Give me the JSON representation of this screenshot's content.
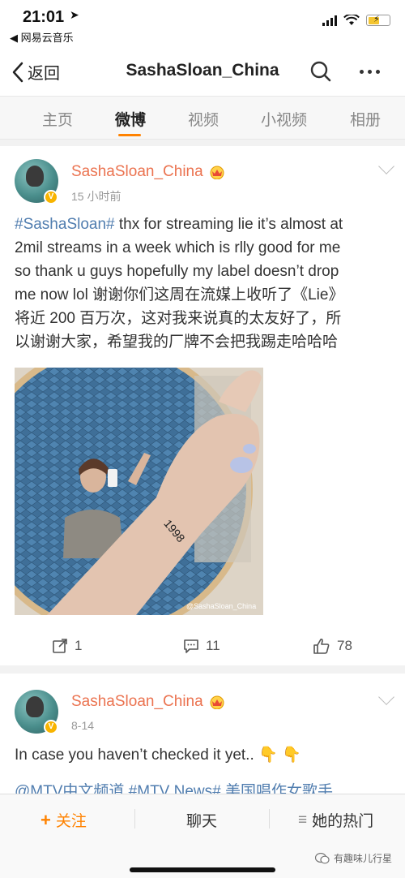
{
  "status": {
    "time": "21:01",
    "back_app": "◀ 网易云音乐"
  },
  "nav": {
    "back_label": "返回",
    "title": "SashaSloan_China"
  },
  "tabs": [
    {
      "label": "主页"
    },
    {
      "label": "微博"
    },
    {
      "label": "视频"
    },
    {
      "label": "小视频"
    },
    {
      "label": "相册"
    }
  ],
  "post1": {
    "username": "SashaSloan_China",
    "time": "15 小时前",
    "hashtag": "#SashaSloan#",
    "text_line1": " thx for streaming lie it’s almost at",
    "text_line2": "2mil streams in a week which is rlly good for me",
    "text_line3": "so thank u guys hopefully my label doesn’t drop",
    "text_line4": "me now lol 谢谢你们这周在流媒上收听了《Lie》",
    "text_line5": "将近 200 百万次，这对我来说真的太友好了，所",
    "text_line6": "以谢谢大家，希望我的厂牌不会把我踢走哈哈哈",
    "photo_watermark": "@SashaSloan_China",
    "reposts": "1",
    "comments": "11",
    "likes": "78"
  },
  "post2": {
    "username": "SashaSloan_China",
    "time": "8-14",
    "text": "In case you haven’t checked it yet.. 👇 👇",
    "snippet": "@MTV中文频道 #MTV News# 美国唱作女歌手"
  },
  "bottom": {
    "follow_plus": "+",
    "follow_label": "关注",
    "chat_label": "聊天",
    "hot_prefix": "≡",
    "hot_label": "她的热门",
    "watermark": "有趣味儿行星"
  },
  "colors": {
    "accent": "#ff8200",
    "username": "#eb7350",
    "link": "#507daf"
  },
  "icons": [
    "location-arrow-icon",
    "signal-icon",
    "wifi-icon",
    "battery-icon",
    "back-chevron-icon",
    "search-icon",
    "more-icon",
    "verified-badge-icon",
    "vip-crown-icon",
    "dropdown-chevron-icon",
    "repost-icon",
    "comment-icon",
    "like-icon"
  ]
}
